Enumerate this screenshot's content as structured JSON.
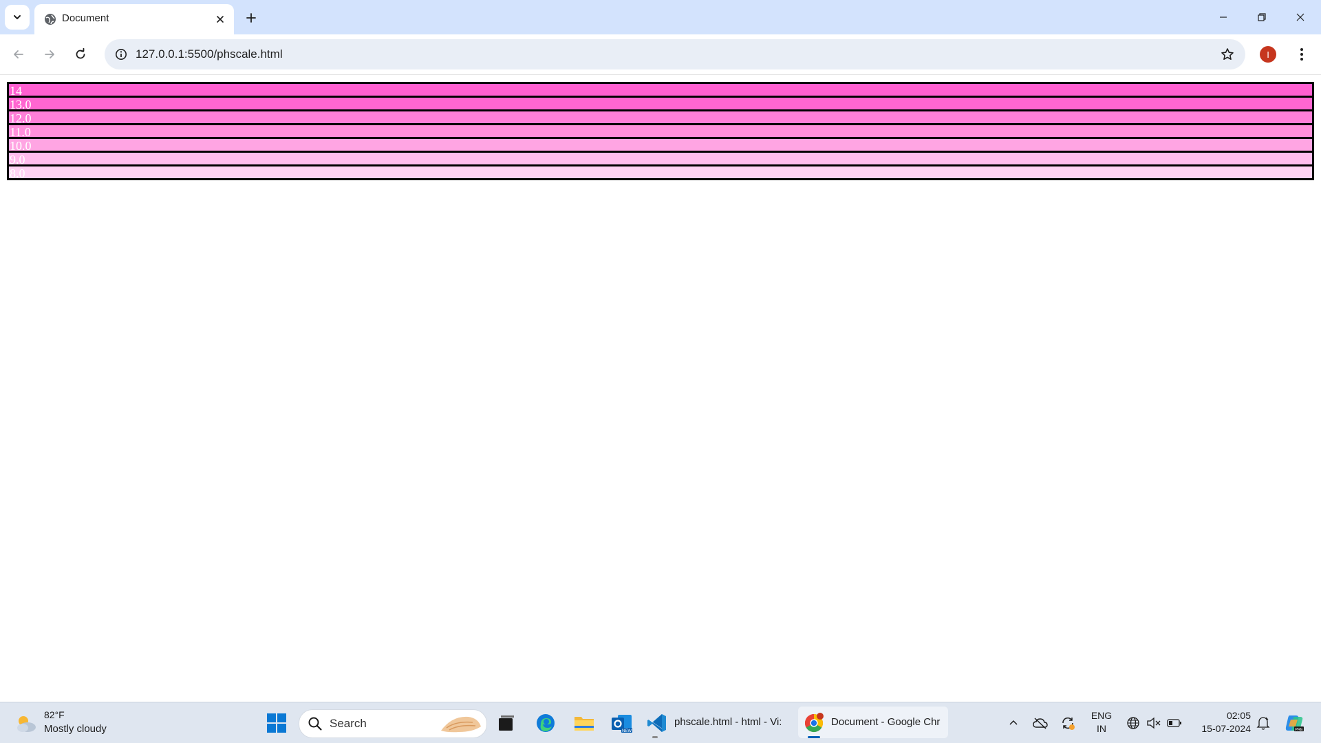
{
  "browser": {
    "tab_title": "Document",
    "url": "127.0.0.1:5500/phscale.html",
    "profile_initial": "I"
  },
  "page": {
    "rows": [
      {
        "label": "14",
        "color": "#ff5fd0"
      },
      {
        "label": "13.0",
        "color": "#ff66d1"
      },
      {
        "label": "12.0",
        "color": "#ff7fd8"
      },
      {
        "label": "11.0",
        "color": "#ff90dc"
      },
      {
        "label": "10.0",
        "color": "#ffa5e3"
      },
      {
        "label": "9.0",
        "color": "#ffbded"
      },
      {
        "label": "8.0",
        "color": "#ffd3f4"
      }
    ]
  },
  "taskbar": {
    "weather_temp": "82°F",
    "weather_desc": "Mostly cloudy",
    "search_placeholder": "Search",
    "apps": {
      "vscode_label": "phscale.html - html - Vi:",
      "chrome_label": "Document - Google Chr"
    },
    "language": "ENG",
    "region": "IN",
    "time": "02:05",
    "date": "15-07-2024"
  }
}
